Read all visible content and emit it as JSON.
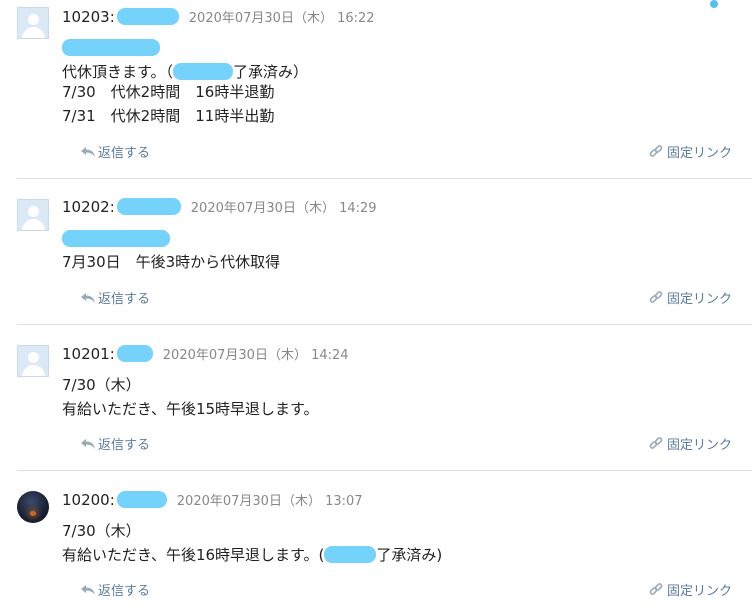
{
  "accent_color": "#74d2fb",
  "link_color": "#5b7b9c",
  "posts": [
    {
      "id": "10203:",
      "timestamp": "2020年07月30日（木） 16:22",
      "body": [
        "代休頂きます。（",
        "7/30　代休2時間　16時半退勤",
        "7/31　代休2時間　11時半出勤"
      ],
      "body_suffix": "了承済み）",
      "reply_label": "返信する",
      "permalink_label": "固定リンク"
    },
    {
      "id": "10202:",
      "timestamp": "2020年07月30日（木） 14:29",
      "body": [
        "7月30日　午後3時から代休取得"
      ],
      "reply_label": "返信する",
      "permalink_label": "固定リンク"
    },
    {
      "id": "10201:",
      "timestamp": "2020年07月30日（木） 14:24",
      "body": [
        "7/30（木）",
        "有給いただき、午後15時早退します。"
      ],
      "reply_label": "返信する",
      "permalink_label": "固定リンク"
    },
    {
      "id": "10200:",
      "timestamp": "2020年07月30日（木） 13:07",
      "body": [
        "7/30（木）",
        "有給いただき、午後16時早退します。("
      ],
      "body_suffix": "了承済み)",
      "reply_label": "返信する",
      "permalink_label": "固定リンク"
    }
  ]
}
